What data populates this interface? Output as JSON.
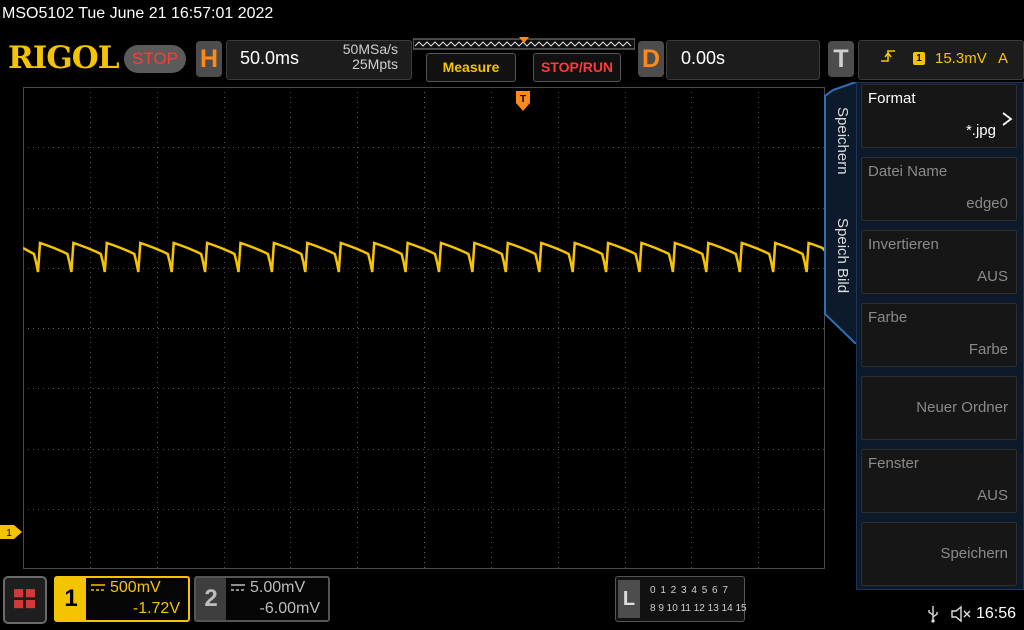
{
  "title_bar": {
    "text": "MSO5102  Tue June 21 16:57:01 2022"
  },
  "header": {
    "brand": "RIGOL",
    "run_status": "STOP",
    "horizontal": {
      "label": "H",
      "timebase": "50.0ms",
      "sample_rate": "50MSa/s",
      "memory_depth": "25Mpts"
    },
    "measure_label": "Measure",
    "stop_run_label": "STOP/RUN",
    "delay": {
      "label": "D",
      "value": "0.00s"
    },
    "trigger": {
      "label": "T",
      "source": "1",
      "level": "15.3mV",
      "mode": "A"
    }
  },
  "side_menu": {
    "tabs": [
      "Speichern",
      "Speich Bild"
    ],
    "items": [
      {
        "label": "Format",
        "value": "*.jpg"
      },
      {
        "label": "Datei Name",
        "value": "edge0"
      },
      {
        "label": "Invertieren",
        "value": "AUS"
      },
      {
        "label": "Farbe",
        "value": "Farbe"
      },
      {
        "label": "",
        "value": "Neuer Ordner"
      },
      {
        "label": "Fenster",
        "value": "AUS"
      },
      {
        "label": "",
        "value": "Speichern"
      }
    ]
  },
  "channels": [
    {
      "number": "1",
      "scale": "500mV",
      "offset": "-1.72V",
      "color": "#f5c400",
      "active": true
    },
    {
      "number": "2",
      "scale": "5.00mV",
      "offset": "-6.00mV",
      "color": "#bdbdbd",
      "active": false
    }
  ],
  "logic_analyzer": {
    "label": "L",
    "row1": "0 1 2 3  4 5 6 7",
    "row2": "8 9 10 11 12 13 14 15"
  },
  "status_bar": {
    "time": "16:56"
  },
  "waveform": {
    "channel": "1",
    "color": "#f5c400",
    "periods_visible": 24
  }
}
